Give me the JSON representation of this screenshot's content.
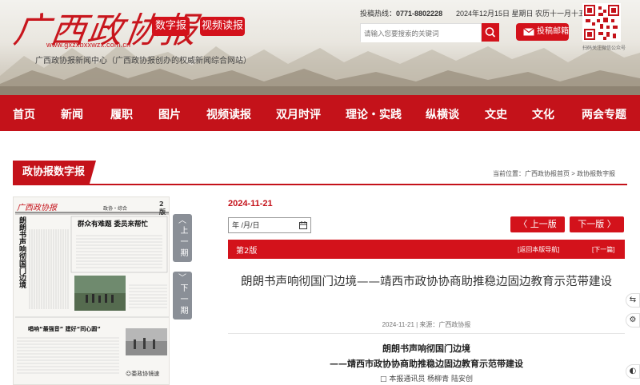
{
  "header": {
    "logo_text": "广西政协报",
    "logo_url": "www.gxzxbxxwzx.com.cn",
    "subtitle": "广西政协报新闻中心（广西政协报创办的权威新闻综合网站）",
    "btn_digital": "数字报",
    "btn_video": "视频读报",
    "hotline_label": "投稿热线：",
    "hotline_number": "0771-8802228",
    "date": "2024年12月15日  星期日  农历十一月十五",
    "search_placeholder": "请输入您要搜索的关键词",
    "mail_label": "投稿邮箱",
    "qr_caption": "扫码关注微信公众号"
  },
  "nav": {
    "items": [
      "首页",
      "新闻",
      "履职",
      "图片",
      "视频读报",
      "双月时评",
      "理论・实践",
      "纵横谈",
      "文史",
      "文化",
      "两会专题"
    ]
  },
  "section": {
    "title": "政协报数字报",
    "breadcrumb": "当前位置：广西政协报首页 > 政协报数字报"
  },
  "paper": {
    "masthead": "广西政协报",
    "section_name": "政协・综合",
    "page_no": "2版",
    "headline_vertical": "朗朗书声响彻国门边境",
    "headline_2": "群众有难题  委员来帮忙",
    "headline_3": "唱响“最强音” 建好“同心圆”",
    "bottom_label": "☺委政协镜速",
    "pager_up_label": "上一期",
    "pager_down_label": "下一期"
  },
  "article": {
    "pub_date": "2024-11-21",
    "date_input": "年 /月/日",
    "prev_label": "〈 上一版",
    "next_label": "下一版 〉",
    "page_name": "第2版",
    "back_label": "[返回本版导航]",
    "next_article": "[下一篇]",
    "title": "朗朗书声响彻国门边境——靖西市政协协商助推稳边固边教育示范带建设",
    "meta": "2024-11-21 | 来源：广西政协报",
    "heading1": "朗朗书声响彻国门边境",
    "heading2": "——靖西市政协协商助推稳边固边教育示范带建设",
    "byline": "□ 本报通讯员 杨柳青 陆安创"
  },
  "float_tools": [
    "⇆",
    "⚙",
    "◐"
  ],
  "colors": {
    "brand_red": "#c4121a",
    "button_red": "#d3121b",
    "pager_gray": "#8a8f97"
  }
}
